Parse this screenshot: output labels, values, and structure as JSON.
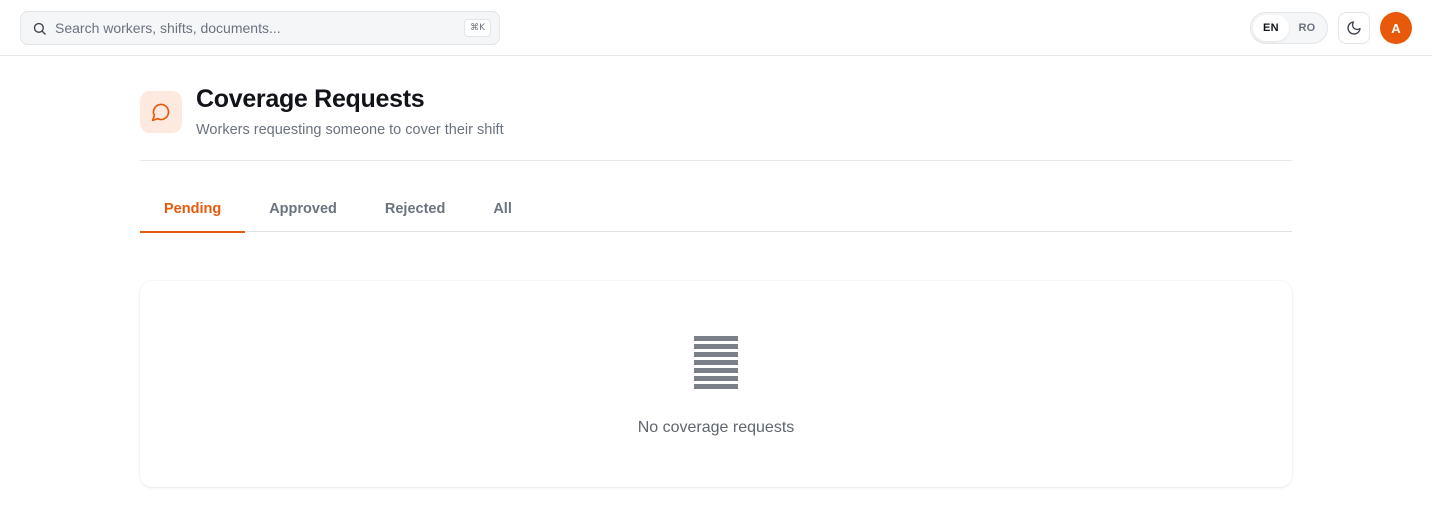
{
  "topbar": {
    "search": {
      "placeholder": "Search workers, shifts, documents...",
      "shortcut": "⌘K",
      "icon": "search-icon"
    },
    "language": {
      "options": [
        "EN",
        "RO"
      ],
      "selected": "EN"
    },
    "theme_toggle": {
      "icon": "moon-icon"
    },
    "avatar": {
      "initial": "A",
      "color": "#e8590c"
    }
  },
  "header": {
    "icon": "message-circle-icon",
    "title": "Coverage Requests",
    "subtitle": "Workers requesting someone to cover their shift"
  },
  "tabs": [
    {
      "label": "Pending",
      "active": true
    },
    {
      "label": "Approved",
      "active": false
    },
    {
      "label": "Rejected",
      "active": false
    },
    {
      "label": "All",
      "active": false
    }
  ],
  "empty_state": {
    "icon": "list-lines-icon",
    "message": "No coverage requests"
  },
  "colors": {
    "accent": "#e8590c",
    "accent_soft": "#fde9dd",
    "muted_text": "#6b7280"
  }
}
